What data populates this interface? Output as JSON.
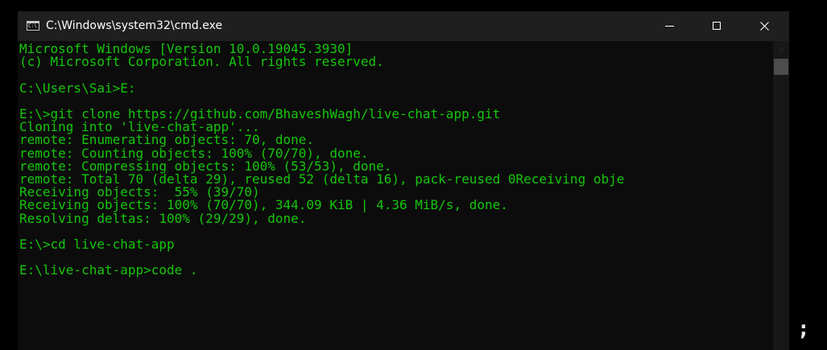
{
  "window": {
    "title": "C:\\Windows\\system32\\cmd.exe",
    "icon": "cmd-icon",
    "controls": {
      "minimize": "minimize-icon",
      "maximize": "maximize-icon",
      "close": "close-icon"
    }
  },
  "console": {
    "text_color": "#16c60c",
    "background": "#0c0c0c",
    "lines": [
      "Microsoft Windows [Version 10.0.19045.3930]",
      "(c) Microsoft Corporation. All rights reserved.",
      "",
      "C:\\Users\\Sai>E:",
      "",
      "E:\\>git clone https://github.com/BhaveshWagh/live-chat-app.git",
      "Cloning into 'live-chat-app'...",
      "remote: Enumerating objects: 70, done.",
      "remote: Counting objects: 100% (70/70), done.",
      "remote: Compressing objects: 100% (53/53), done.",
      "remote: Total 70 (delta 29), reused 52 (delta 16), pack-reused 0Receiving obje",
      "Receiving objects:  55% (39/70)",
      "Receiving objects: 100% (70/70), 344.09 KiB | 4.36 MiB/s, done.",
      "Resolving deltas: 100% (29/29), done.",
      "",
      "E:\\>cd live-chat-app",
      "",
      "E:\\live-chat-app>code ."
    ]
  },
  "outside_mark": ";"
}
